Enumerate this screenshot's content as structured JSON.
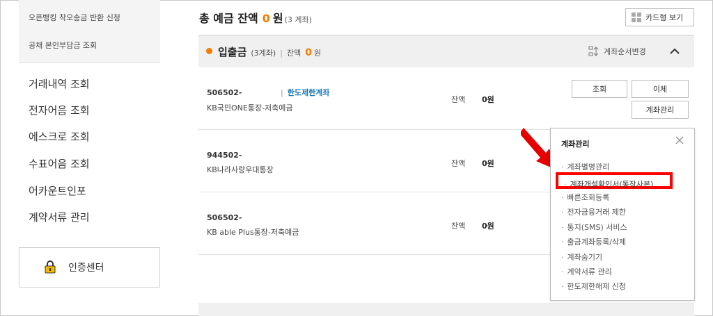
{
  "sidebar": {
    "sub_items": [
      "오픈뱅킹 착오송금 반환 신청",
      "공채 본인부담금 조회"
    ],
    "menu": [
      "거래내역 조회",
      "전자어음 조회",
      "에스크로 조회",
      "수표어음 조회",
      "어카운트인포",
      "계약서류 관리"
    ],
    "cert_label": "인증센터"
  },
  "summary": {
    "title": "총 예금 잔액",
    "amount": "0",
    "unit": "원",
    "count": "(3 계좌)",
    "card_view_label": "카드형 보기"
  },
  "section": {
    "title": "입출금",
    "count": "(3계좌)",
    "balance_label": "잔액",
    "balance_amount": "0",
    "balance_unit": "원",
    "order_label": "계좌순서변경"
  },
  "accounts": [
    {
      "number": "506502-",
      "limit_label": "한도제한계좌",
      "name": "KB국민ONE통장-저축예금",
      "balance_label": "잔액",
      "balance": "0원"
    },
    {
      "number": "944502-",
      "name": "KB나라사랑우대통장",
      "balance_label": "잔액",
      "balance": "0원"
    },
    {
      "number": "506502-",
      "name": "KB able Plus통장-저축예금",
      "balance_label": "잔액",
      "balance": "0원"
    }
  ],
  "buttons": {
    "inquiry": "조회",
    "transfer": "이체",
    "manage": "계좌관리"
  },
  "popup": {
    "title": "계좌관리",
    "items": [
      "계좌별명관리",
      "계좌개설확인서(통장사본)",
      "빠른조회등록",
      "전자금융거래 제한",
      "통지(SMS) 서비스",
      "출금계좌등록/삭제",
      "계좌숨기기",
      "계약서류 관리",
      "한도제한해제 신청"
    ],
    "highlighted_index": 1
  },
  "colors": {
    "accent": "#f07d00",
    "link": "#1a78b4",
    "highlight": "#ff0000"
  }
}
